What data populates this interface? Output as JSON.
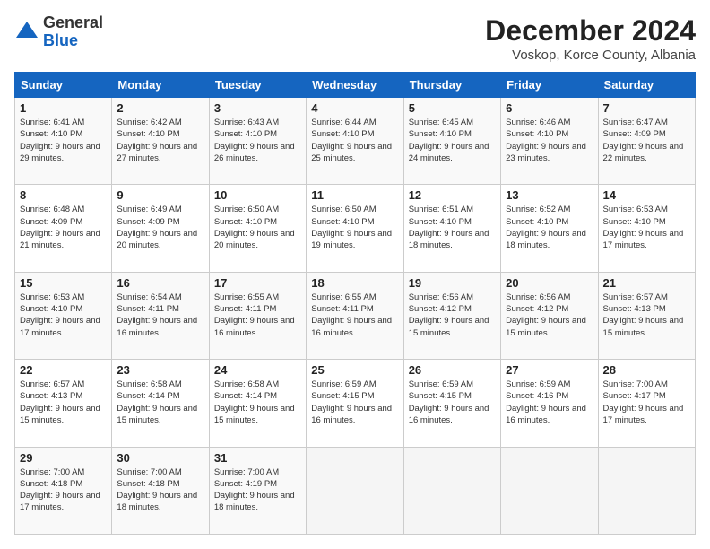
{
  "header": {
    "logo_general": "General",
    "logo_blue": "Blue",
    "main_title": "December 2024",
    "subtitle": "Voskop, Korce County, Albania"
  },
  "columns": [
    "Sunday",
    "Monday",
    "Tuesday",
    "Wednesday",
    "Thursday",
    "Friday",
    "Saturday"
  ],
  "weeks": [
    [
      {
        "day": "1",
        "sunrise": "Sunrise: 6:41 AM",
        "sunset": "Sunset: 4:10 PM",
        "daylight": "Daylight: 9 hours and 29 minutes."
      },
      {
        "day": "2",
        "sunrise": "Sunrise: 6:42 AM",
        "sunset": "Sunset: 4:10 PM",
        "daylight": "Daylight: 9 hours and 27 minutes."
      },
      {
        "day": "3",
        "sunrise": "Sunrise: 6:43 AM",
        "sunset": "Sunset: 4:10 PM",
        "daylight": "Daylight: 9 hours and 26 minutes."
      },
      {
        "day": "4",
        "sunrise": "Sunrise: 6:44 AM",
        "sunset": "Sunset: 4:10 PM",
        "daylight": "Daylight: 9 hours and 25 minutes."
      },
      {
        "day": "5",
        "sunrise": "Sunrise: 6:45 AM",
        "sunset": "Sunset: 4:10 PM",
        "daylight": "Daylight: 9 hours and 24 minutes."
      },
      {
        "day": "6",
        "sunrise": "Sunrise: 6:46 AM",
        "sunset": "Sunset: 4:10 PM",
        "daylight": "Daylight: 9 hours and 23 minutes."
      },
      {
        "day": "7",
        "sunrise": "Sunrise: 6:47 AM",
        "sunset": "Sunset: 4:09 PM",
        "daylight": "Daylight: 9 hours and 22 minutes."
      }
    ],
    [
      {
        "day": "8",
        "sunrise": "Sunrise: 6:48 AM",
        "sunset": "Sunset: 4:09 PM",
        "daylight": "Daylight: 9 hours and 21 minutes."
      },
      {
        "day": "9",
        "sunrise": "Sunrise: 6:49 AM",
        "sunset": "Sunset: 4:09 PM",
        "daylight": "Daylight: 9 hours and 20 minutes."
      },
      {
        "day": "10",
        "sunrise": "Sunrise: 6:50 AM",
        "sunset": "Sunset: 4:10 PM",
        "daylight": "Daylight: 9 hours and 20 minutes."
      },
      {
        "day": "11",
        "sunrise": "Sunrise: 6:50 AM",
        "sunset": "Sunset: 4:10 PM",
        "daylight": "Daylight: 9 hours and 19 minutes."
      },
      {
        "day": "12",
        "sunrise": "Sunrise: 6:51 AM",
        "sunset": "Sunset: 4:10 PM",
        "daylight": "Daylight: 9 hours and 18 minutes."
      },
      {
        "day": "13",
        "sunrise": "Sunrise: 6:52 AM",
        "sunset": "Sunset: 4:10 PM",
        "daylight": "Daylight: 9 hours and 18 minutes."
      },
      {
        "day": "14",
        "sunrise": "Sunrise: 6:53 AM",
        "sunset": "Sunset: 4:10 PM",
        "daylight": "Daylight: 9 hours and 17 minutes."
      }
    ],
    [
      {
        "day": "15",
        "sunrise": "Sunrise: 6:53 AM",
        "sunset": "Sunset: 4:10 PM",
        "daylight": "Daylight: 9 hours and 17 minutes."
      },
      {
        "day": "16",
        "sunrise": "Sunrise: 6:54 AM",
        "sunset": "Sunset: 4:11 PM",
        "daylight": "Daylight: 9 hours and 16 minutes."
      },
      {
        "day": "17",
        "sunrise": "Sunrise: 6:55 AM",
        "sunset": "Sunset: 4:11 PM",
        "daylight": "Daylight: 9 hours and 16 minutes."
      },
      {
        "day": "18",
        "sunrise": "Sunrise: 6:55 AM",
        "sunset": "Sunset: 4:11 PM",
        "daylight": "Daylight: 9 hours and 16 minutes."
      },
      {
        "day": "19",
        "sunrise": "Sunrise: 6:56 AM",
        "sunset": "Sunset: 4:12 PM",
        "daylight": "Daylight: 9 hours and 15 minutes."
      },
      {
        "day": "20",
        "sunrise": "Sunrise: 6:56 AM",
        "sunset": "Sunset: 4:12 PM",
        "daylight": "Daylight: 9 hours and 15 minutes."
      },
      {
        "day": "21",
        "sunrise": "Sunrise: 6:57 AM",
        "sunset": "Sunset: 4:13 PM",
        "daylight": "Daylight: 9 hours and 15 minutes."
      }
    ],
    [
      {
        "day": "22",
        "sunrise": "Sunrise: 6:57 AM",
        "sunset": "Sunset: 4:13 PM",
        "daylight": "Daylight: 9 hours and 15 minutes."
      },
      {
        "day": "23",
        "sunrise": "Sunrise: 6:58 AM",
        "sunset": "Sunset: 4:14 PM",
        "daylight": "Daylight: 9 hours and 15 minutes."
      },
      {
        "day": "24",
        "sunrise": "Sunrise: 6:58 AM",
        "sunset": "Sunset: 4:14 PM",
        "daylight": "Daylight: 9 hours and 15 minutes."
      },
      {
        "day": "25",
        "sunrise": "Sunrise: 6:59 AM",
        "sunset": "Sunset: 4:15 PM",
        "daylight": "Daylight: 9 hours and 16 minutes."
      },
      {
        "day": "26",
        "sunrise": "Sunrise: 6:59 AM",
        "sunset": "Sunset: 4:15 PM",
        "daylight": "Daylight: 9 hours and 16 minutes."
      },
      {
        "day": "27",
        "sunrise": "Sunrise: 6:59 AM",
        "sunset": "Sunset: 4:16 PM",
        "daylight": "Daylight: 9 hours and 16 minutes."
      },
      {
        "day": "28",
        "sunrise": "Sunrise: 7:00 AM",
        "sunset": "Sunset: 4:17 PM",
        "daylight": "Daylight: 9 hours and 17 minutes."
      }
    ],
    [
      {
        "day": "29",
        "sunrise": "Sunrise: 7:00 AM",
        "sunset": "Sunset: 4:18 PM",
        "daylight": "Daylight: 9 hours and 17 minutes."
      },
      {
        "day": "30",
        "sunrise": "Sunrise: 7:00 AM",
        "sunset": "Sunset: 4:18 PM",
        "daylight": "Daylight: 9 hours and 18 minutes."
      },
      {
        "day": "31",
        "sunrise": "Sunrise: 7:00 AM",
        "sunset": "Sunset: 4:19 PM",
        "daylight": "Daylight: 9 hours and 18 minutes."
      },
      null,
      null,
      null,
      null
    ]
  ]
}
